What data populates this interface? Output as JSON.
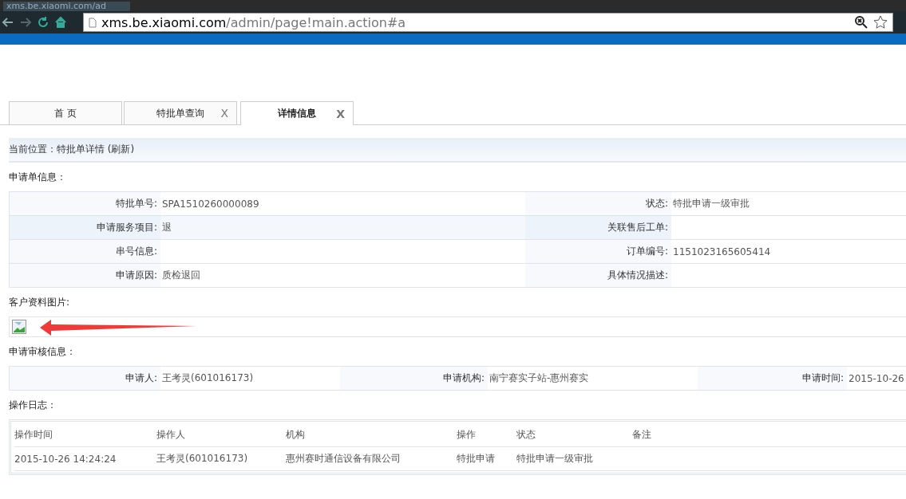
{
  "browser": {
    "tab_title": "xms.be.xiaomi.com/ad",
    "url_host": "xms.be.xiaomi.com",
    "url_path": "/admin/page!main.action#a"
  },
  "tabs": [
    {
      "label": "首 页",
      "selected": false
    },
    {
      "label": "特批单查询",
      "selected": false,
      "close": "X"
    },
    {
      "label": "详情信息",
      "selected": true,
      "close": "X"
    }
  ],
  "breadcrumb": "当前位置：特批单详情 (刷新)",
  "application": {
    "title": "申请单信息：",
    "rows": [
      [
        {
          "label": "特批单号:",
          "value": "SPA1510260000089"
        },
        {
          "label": "状态:",
          "value": "特批申请一级审批"
        }
      ],
      [
        {
          "label": "申请服务项目:",
          "value": "退"
        },
        {
          "label": "关联售后工单:"
        }
      ],
      [
        {
          "label": "串号信息:"
        },
        {
          "label": "订单编号:",
          "value": "1151023165605414"
        }
      ],
      [
        {
          "label": "申请原因:",
          "value": "质检退回"
        },
        {
          "label": "具体情况描述:"
        }
      ]
    ]
  },
  "images": {
    "title": "客户资料图片:"
  },
  "review": {
    "title": "申请审核信息：",
    "fields": [
      {
        "label": "申请人:",
        "value": "王考灵(601016173)"
      },
      {
        "label": "申请机构:",
        "value": "南宁赛实子站-惠州赛实"
      },
      {
        "label": "申请时间:",
        "value": "2015-10-26"
      }
    ]
  },
  "log": {
    "title": "操作日志：",
    "columns": [
      "操作时间",
      "操作人",
      "机构",
      "操作",
      "状态",
      "备注"
    ],
    "rows": [
      [
        "2015-10-26 14:24:24",
        "王考灵(601016173)",
        "惠州赛时通信设备有限公司",
        "特批申请",
        "特批申请一级审批"
      ]
    ]
  }
}
